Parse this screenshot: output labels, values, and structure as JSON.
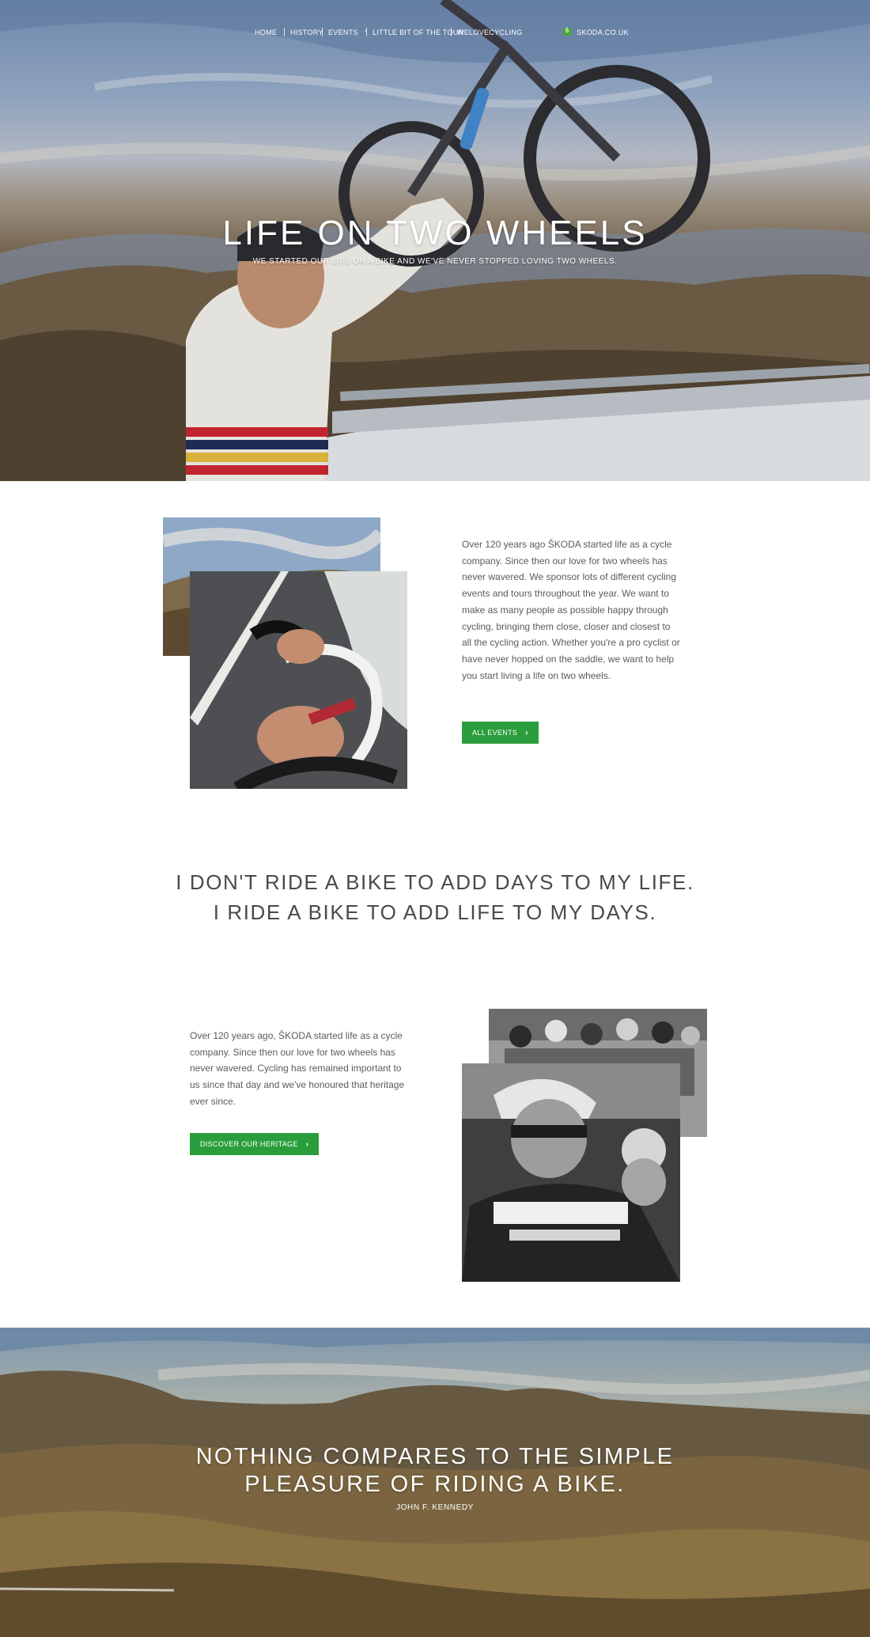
{
  "nav": {
    "items": [
      "HOME",
      "HISTORY",
      "EVENTS",
      "LITTLE BIT OF THE TOUR",
      "WELOVECYCLING"
    ],
    "events_caret": "^",
    "brand_link": "SKODA.CO.UK"
  },
  "hero": {
    "title": "LIFE ON TWO WHEELS",
    "subtitle": "WE STARTED OUR LIFE ON A BIKE AND WE'VE NEVER STOPPED LOVING TWO WHEELS."
  },
  "intro": {
    "paragraph": "Over 120 years ago ŠKODA started life as a cycle company. Since then our love for two wheels has never wavered. We sponsor lots of different cycling events and tours throughout the year. We want to make as many people as possible happy through cycling, bringing them close, closer and closest to all the cycling action. Whether you're a pro cyclist or have never hopped on the saddle, we want to help you start living a life on two wheels.",
    "button": "ALL EVENTS"
  },
  "quote": {
    "line1": "I DON'T RIDE A BIKE TO ADD DAYS TO MY LIFE.",
    "line2": "I RIDE A BIKE TO ADD LIFE TO MY DAYS."
  },
  "heritage": {
    "paragraph": "Over 120 years ago, ŠKODA started life as a cycle company. Since then our love for two wheels has never wavered. Cycling has remained important to us since that day and we've honoured that heritage ever since.",
    "button": "DISCOVER OUR HERITAGE"
  },
  "banner": {
    "quote_line1": "NOTHING COMPARES TO THE SIMPLE",
    "quote_line2": "PLEASURE OF RIDING A BIKE.",
    "author": "JOHN F. KENNEDY"
  },
  "colors": {
    "accent": "#2a9e3c",
    "text": "#5b5b5b",
    "logo": "#4ba82e"
  }
}
